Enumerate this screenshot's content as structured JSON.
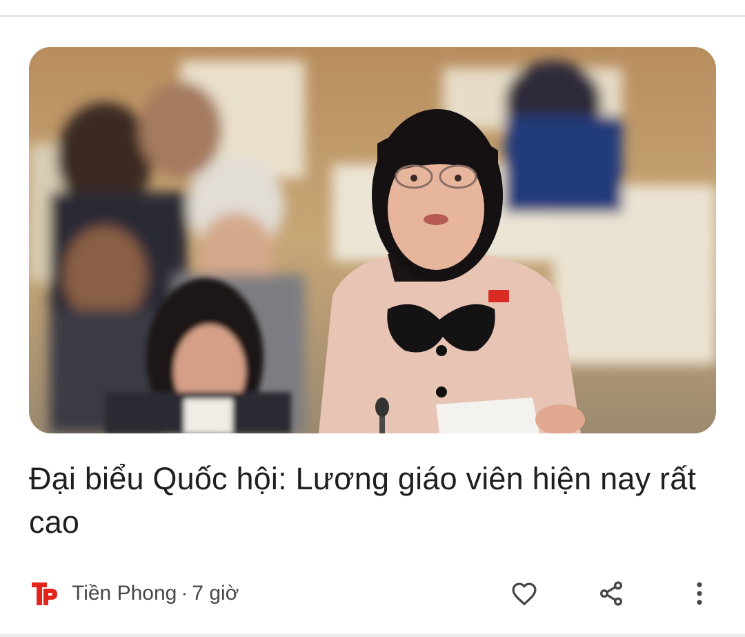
{
  "article": {
    "image_alt": "Đại biểu Quốc hội phát biểu",
    "headline": "Đại biểu Quốc hội: Lương giáo viên hiện nay rất cao",
    "source": {
      "name": "Tiền Phong",
      "logo_text": "TP",
      "logo_color": "#e3241b",
      "separator": "·",
      "time": "7 giờ"
    }
  },
  "actions": {
    "like_icon": "heart-outline-icon",
    "share_icon": "share-icon",
    "more_icon": "more-vertical-icon"
  },
  "colors": {
    "text": "#1f1f1f",
    "secondary": "#444746",
    "icon": "#444746"
  }
}
